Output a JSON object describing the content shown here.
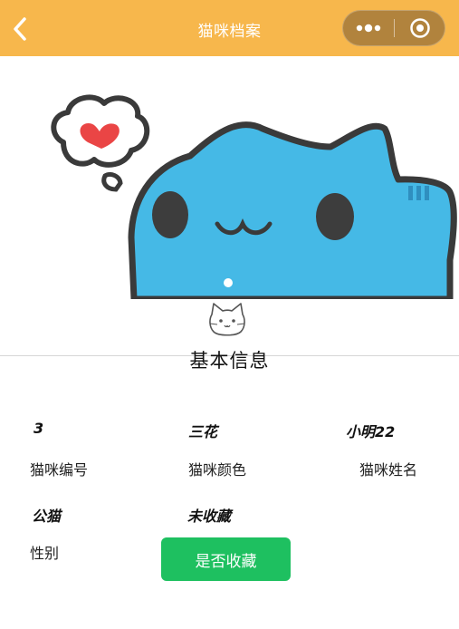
{
  "navbar": {
    "title": "猫咪档案"
  },
  "section": {
    "title": "基本信息"
  },
  "fields": {
    "id": {
      "value": "3",
      "label": "猫咪编号"
    },
    "color": {
      "value": "三花",
      "label": "猫咪颜色"
    },
    "name": {
      "value": "小明22",
      "label": "猫咪姓名"
    },
    "gender": {
      "value": "公猫",
      "label": "性别"
    },
    "favorite": {
      "value": "未收藏",
      "button_label": "是否收藏"
    }
  },
  "colors": {
    "navbar": "#f7b74c",
    "button": "#1ec060",
    "cat_body": "#45b9e6"
  },
  "icons": {
    "back": "chevron-left-icon",
    "more": "more-dots-icon",
    "close": "target-circle-icon",
    "cat": "cat-face-icon"
  }
}
